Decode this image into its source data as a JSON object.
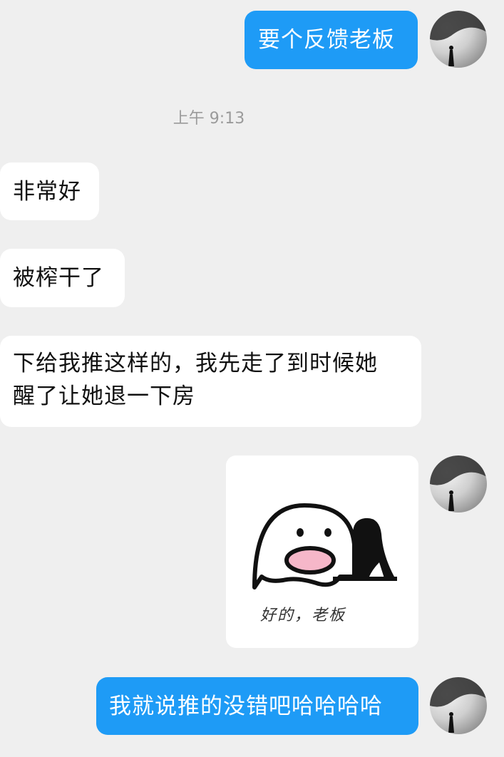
{
  "messages": {
    "m1": "要个反馈老板",
    "time": "上午 9:13",
    "m2": "非常好",
    "m3": "被榨干了",
    "m4_line1": "下给我推这样的，我先走了到时候她",
    "m4_line2": "醒了让她退一下房",
    "sticker_caption": "好的，老板",
    "m5": "我就说推的没错吧哈哈哈哈"
  },
  "colors": {
    "outgoing_bubble": "#1e9bf6",
    "incoming_bubble": "#ffffff",
    "background": "#efefef"
  },
  "icons": {
    "avatar": "user-avatar-icon",
    "sticker": "blob-character-with-high-heel-sticker"
  }
}
